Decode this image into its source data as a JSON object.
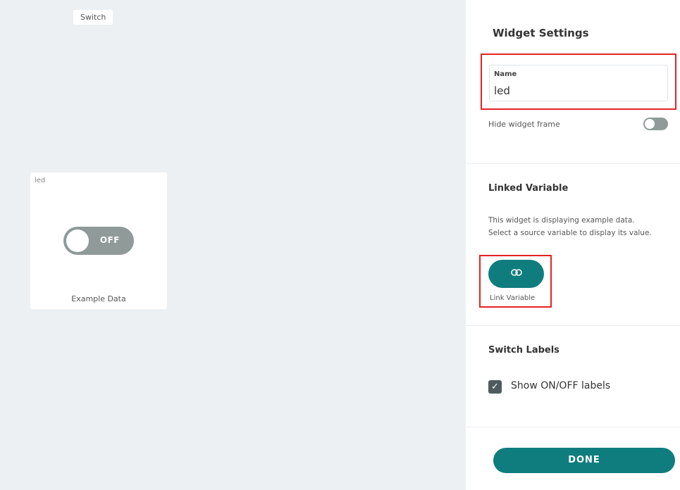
{
  "canvas": {
    "switch_tag": "Switch",
    "widget": {
      "name_partial": "led",
      "toggle_text": "OFF",
      "caption": "Example Data"
    }
  },
  "panel": {
    "title": "Widget Settings",
    "name_label": "Name",
    "name_value": "led",
    "hide_frame_label": "Hide widget frame",
    "linked_variable_title": "Linked Variable",
    "help_line1": "This widget is displaying example data.",
    "help_line2": "Select a source variable to display its value.",
    "link_icon": "link-icon",
    "link_variable_label": "Link Variable",
    "switch_labels_title": "Switch Labels",
    "show_labels": "Show ON/OFF labels",
    "done_label": "DONE"
  },
  "colors": {
    "accent": "#0f7d7e",
    "highlight": "#e52222",
    "toggle_off": "#8f9a99"
  }
}
